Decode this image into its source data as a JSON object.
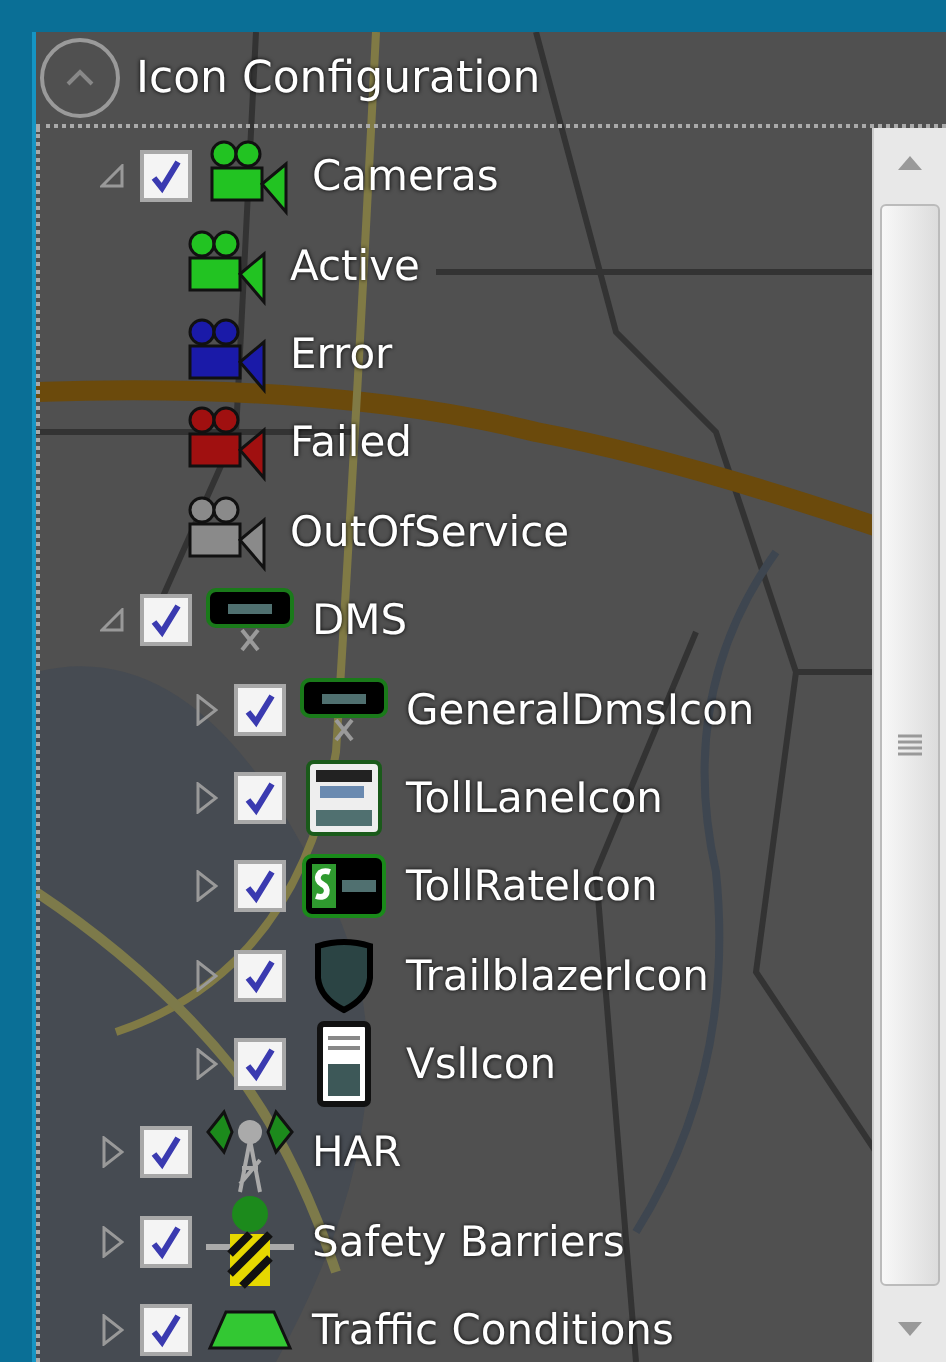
{
  "panel": {
    "title": "Icon Configuration"
  },
  "tree": [
    {
      "label": "Cameras",
      "kind": "camera",
      "color": "#22c322",
      "checked": true,
      "expanded": true,
      "children": [
        {
          "label": "Active",
          "kind": "camera",
          "color": "#22c322"
        },
        {
          "label": "Error",
          "kind": "camera",
          "color": "#1a1aa8"
        },
        {
          "label": "Failed",
          "kind": "camera",
          "color": "#a01010"
        },
        {
          "label": "OutOfService",
          "kind": "camera",
          "color": "#8a8a8a"
        }
      ]
    },
    {
      "label": "DMS",
      "kind": "sign",
      "checked": true,
      "expanded": true,
      "children": [
        {
          "label": "GeneralDmsIcon",
          "kind": "sign",
          "checked": true,
          "expanded": false
        },
        {
          "label": "TollLaneIcon",
          "kind": "toll-lane",
          "checked": true,
          "expanded": false
        },
        {
          "label": "TollRateIcon",
          "kind": "toll-rate",
          "checked": true,
          "expanded": false
        },
        {
          "label": "TrailblazerIcon",
          "kind": "shield",
          "checked": true,
          "expanded": false
        },
        {
          "label": "VslIcon",
          "kind": "vsl",
          "checked": true,
          "expanded": false
        }
      ]
    },
    {
      "label": "HAR",
      "kind": "tower",
      "checked": true,
      "expanded": false
    },
    {
      "label": "Safety Barriers",
      "kind": "barrier",
      "checked": true,
      "expanded": false
    },
    {
      "label": "Traffic Conditions",
      "kind": "trapezoid",
      "checked": true,
      "expanded": false
    }
  ]
}
